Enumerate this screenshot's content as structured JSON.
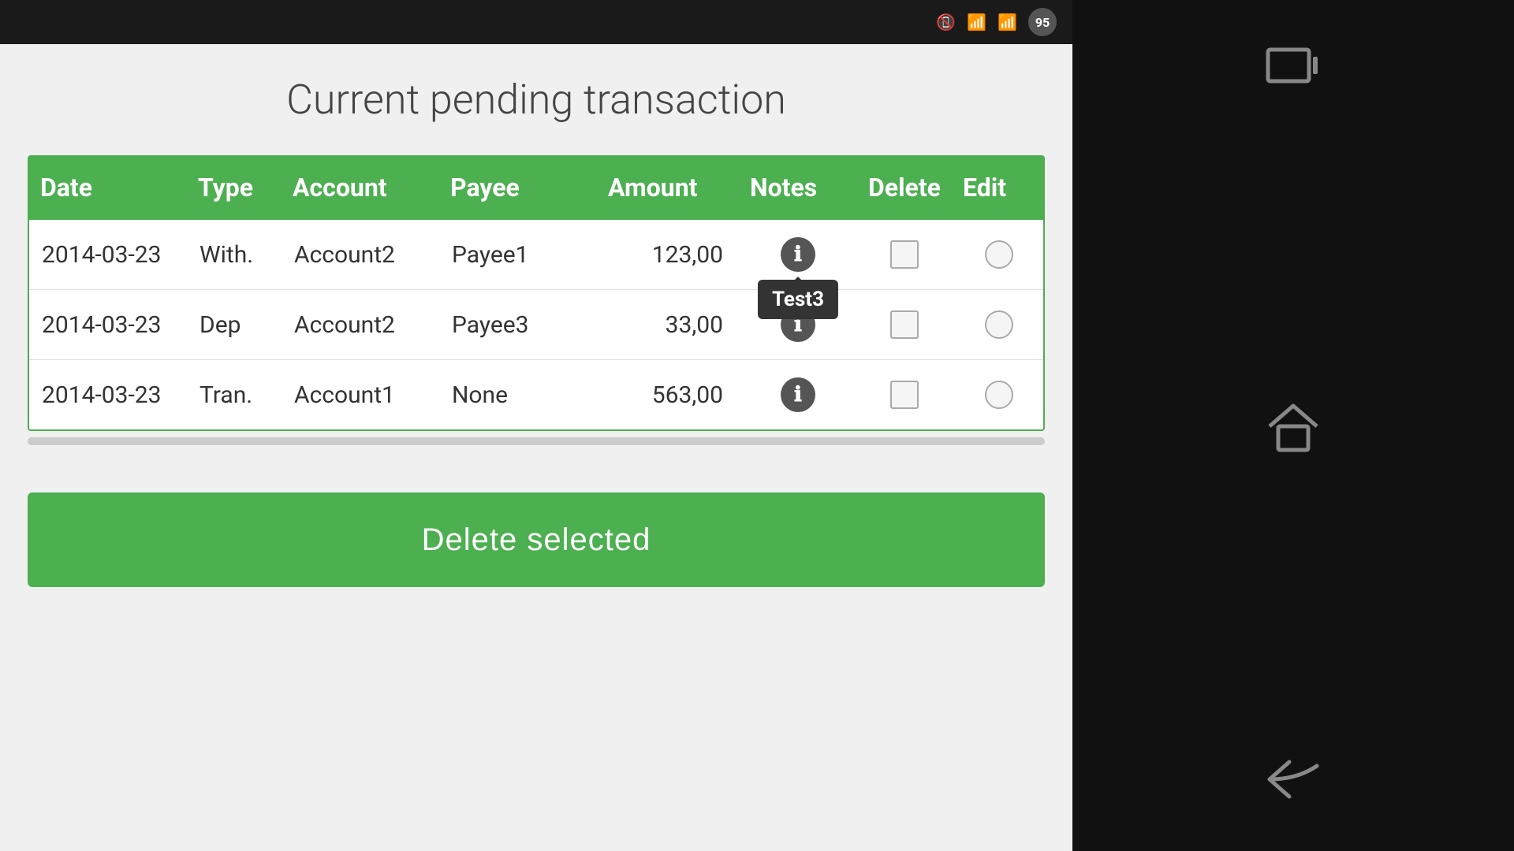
{
  "page": {
    "title": "Current pending transaction",
    "status_bar": {
      "battery": "95"
    }
  },
  "table": {
    "headers": [
      "Date",
      "Type",
      "Account",
      "Payee",
      "Amount",
      "Notes",
      "Delete",
      "Edit"
    ],
    "rows": [
      {
        "date": "2014-03-23",
        "type": "With.",
        "account": "Account2",
        "payee": "Payee1",
        "amount": "123,00",
        "notes_tooltip": "Test3",
        "has_tooltip": true
      },
      {
        "date": "2014-03-23",
        "type": "Dep",
        "account": "Account2",
        "payee": "Payee3",
        "amount": "33,00",
        "notes_tooltip": "",
        "has_tooltip": false
      },
      {
        "date": "2014-03-23",
        "type": "Tran.",
        "account": "Account1",
        "payee": "None",
        "amount": "563,00",
        "notes_tooltip": "",
        "has_tooltip": false
      }
    ]
  },
  "buttons": {
    "delete_selected": "Delete selected"
  }
}
